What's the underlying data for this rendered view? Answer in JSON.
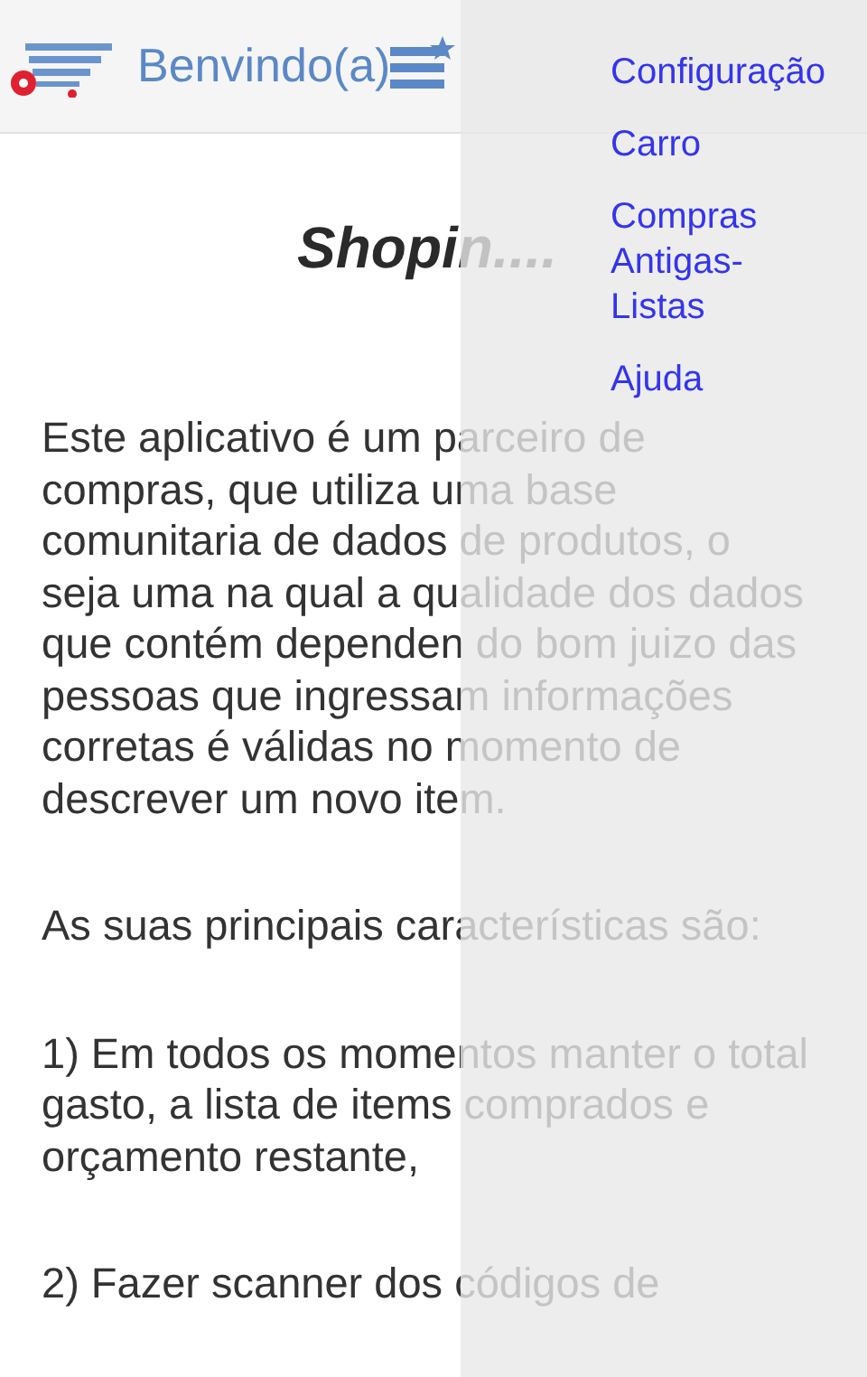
{
  "header": {
    "title": "Benvindo(a)"
  },
  "content": {
    "title": "Shopin....",
    "paragraphs": [
      "Este aplicativo é um parceiro de compras, que utiliza uma base comunitaria de dados de produtos, o seja uma na qual a qualidade dos dados que contém dependen do bom juizo das pessoas que ingressam informações corretas é válidas no momento de descrever um novo item.",
      "As suas principais características são:",
      "1) Em todos os momentos manter o total gasto, a lista de items comprados e orçamento restante,",
      "2) Fazer scanner dos códigos de"
    ]
  },
  "drawer": {
    "items": [
      {
        "label": "Configuração"
      },
      {
        "label": "Carro"
      },
      {
        "label": "Compras Antigas-Listas"
      },
      {
        "label": "Ajuda"
      }
    ]
  }
}
